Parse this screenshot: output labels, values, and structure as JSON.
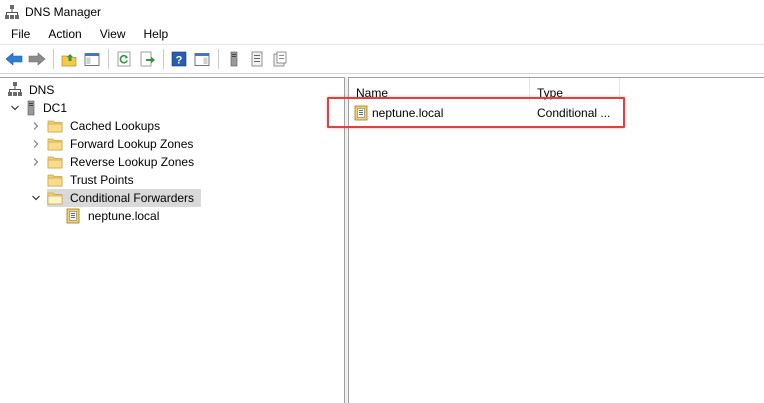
{
  "window": {
    "title": "DNS Manager",
    "icon": "dns-manager-icon"
  },
  "menu": {
    "items": [
      "File",
      "Action",
      "View",
      "Help"
    ]
  },
  "toolbar": {
    "buttons": [
      "back-icon",
      "forward-icon",
      "up-folder-icon",
      "show-hide-tree-icon",
      "refresh-icon",
      "export-list-icon",
      "help-icon",
      "action-pane-icon",
      "server-icon",
      "list-view-icon",
      "properties-icon"
    ]
  },
  "tree": {
    "root": "DNS",
    "server": "DC1",
    "nodes": [
      {
        "label": "Cached Lookups",
        "expanded": false
      },
      {
        "label": "Forward Lookup Zones",
        "expanded": false
      },
      {
        "label": "Reverse Lookup Zones",
        "expanded": false
      },
      {
        "label": "Trust Points",
        "expanded": null
      },
      {
        "label": "Conditional Forwarders",
        "expanded": true,
        "selected": true
      }
    ],
    "child": "neptune.local"
  },
  "list": {
    "columns": [
      "Name",
      "Type"
    ],
    "rows": [
      {
        "name": "neptune.local",
        "type": "Conditional ..."
      }
    ]
  },
  "colors": {
    "highlight": "#e24040",
    "selected": "#d9d9d9",
    "folder": "#f4d074"
  }
}
